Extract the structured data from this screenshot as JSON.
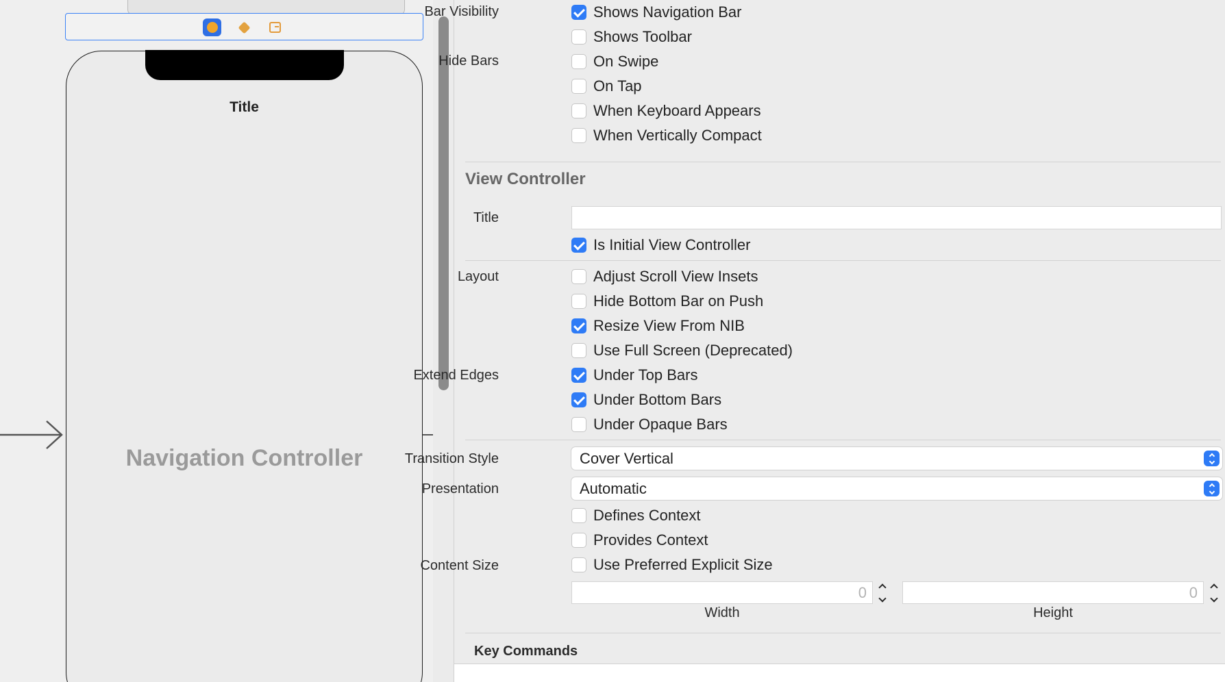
{
  "canvas": {
    "phone_title": "Title",
    "scene_label": "Navigation Controller",
    "dock_icons": [
      "view-controller-icon",
      "first-responder-icon",
      "exit-icon"
    ]
  },
  "inspector": {
    "bar_visibility": {
      "label": "Bar Visibility",
      "shows_navigation_bar": {
        "text": "Shows Navigation Bar",
        "checked": true
      },
      "shows_toolbar": {
        "text": "Shows Toolbar",
        "checked": false
      }
    },
    "hide_bars": {
      "label": "Hide Bars",
      "on_swipe": {
        "text": "On Swipe",
        "checked": false
      },
      "on_tap": {
        "text": "On Tap",
        "checked": false
      },
      "when_keyboard_appears": {
        "text": "When Keyboard Appears",
        "checked": false
      },
      "when_vertically_compact": {
        "text": "When Vertically Compact",
        "checked": false
      }
    },
    "view_controller": {
      "section_title": "View Controller",
      "title_label": "Title",
      "title_value": "",
      "is_initial": {
        "text": "Is Initial View Controller",
        "checked": true
      }
    },
    "layout": {
      "label": "Layout",
      "adjust_scroll": {
        "text": "Adjust Scroll View Insets",
        "checked": false
      },
      "hide_bottom_bar": {
        "text": "Hide Bottom Bar on Push",
        "checked": false
      },
      "resize_from_nib": {
        "text": "Resize View From NIB",
        "checked": true
      },
      "use_full_screen": {
        "text": "Use Full Screen (Deprecated)",
        "checked": false
      }
    },
    "extend_edges": {
      "label": "Extend Edges",
      "under_top_bars": {
        "text": "Under Top Bars",
        "checked": true
      },
      "under_bottom_bars": {
        "text": "Under Bottom Bars",
        "checked": true
      },
      "under_opaque_bars": {
        "text": "Under Opaque Bars",
        "checked": false
      }
    },
    "transition_style": {
      "label": "Transition Style",
      "value": "Cover Vertical"
    },
    "presentation": {
      "label": "Presentation",
      "value": "Automatic",
      "defines_context": {
        "text": "Defines Context",
        "checked": false
      },
      "provides_context": {
        "text": "Provides Context",
        "checked": false
      }
    },
    "content_size": {
      "label": "Content Size",
      "use_preferred": {
        "text": "Use Preferred Explicit Size",
        "checked": false
      },
      "width_value": "0",
      "width_caption": "Width",
      "height_value": "0",
      "height_caption": "Height"
    },
    "key_commands": "Key Commands"
  }
}
